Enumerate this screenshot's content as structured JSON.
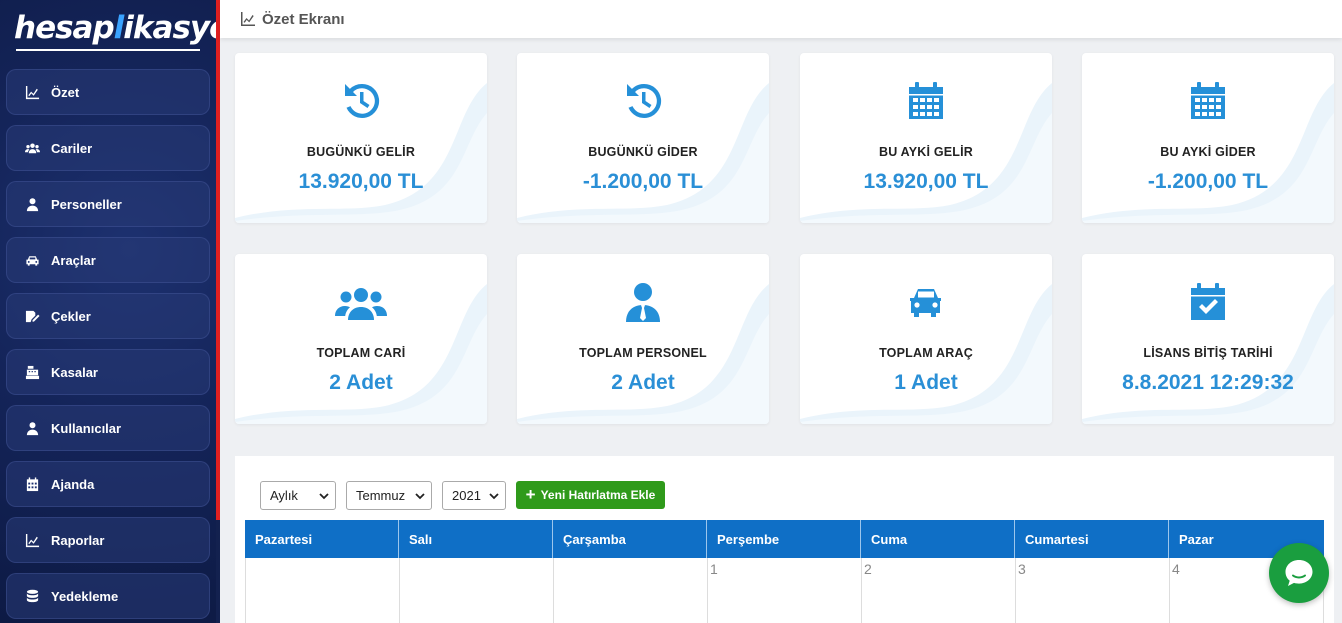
{
  "app": {
    "logo_left": "hesap",
    "logo_accent": "l",
    "logo_right": "ikasyon"
  },
  "sidebar": {
    "items": [
      {
        "label": "Özet",
        "icon": "chart-line-icon"
      },
      {
        "label": "Cariler",
        "icon": "users-icon"
      },
      {
        "label": "Personeller",
        "icon": "user-icon"
      },
      {
        "label": "Araçlar",
        "icon": "car-icon"
      },
      {
        "label": "Çekler",
        "icon": "check-edit-icon"
      },
      {
        "label": "Kasalar",
        "icon": "cash-register-icon"
      },
      {
        "label": "Kullanıcılar",
        "icon": "user-icon"
      },
      {
        "label": "Ajanda",
        "icon": "calendar-icon"
      },
      {
        "label": "Raporlar",
        "icon": "chart-line-icon"
      },
      {
        "label": "Yedekleme",
        "icon": "database-icon"
      }
    ]
  },
  "header": {
    "title": "Özet Ekranı"
  },
  "cards": [
    {
      "label": "BUGÜNKÜ GELİR",
      "value": "13.920,00 TL",
      "icon": "history-icon"
    },
    {
      "label": "BUGÜNKÜ GİDER",
      "value": "-1.200,00 TL",
      "icon": "history-icon"
    },
    {
      "label": "BU AYKİ GELİR",
      "value": "13.920,00 TL",
      "icon": "calendar-icon"
    },
    {
      "label": "BU AYKİ GİDER",
      "value": "-1.200,00 TL",
      "icon": "calendar-icon"
    },
    {
      "label": "TOPLAM CARİ",
      "value": "2 Adet",
      "icon": "users-icon"
    },
    {
      "label": "TOPLAM PERSONEL",
      "value": "2 Adet",
      "icon": "user-tie-icon"
    },
    {
      "label": "TOPLAM ARAÇ",
      "value": "1 Adet",
      "icon": "car-icon"
    },
    {
      "label": "LİSANS BİTİŞ TARİHİ",
      "value": "8.8.2021 12:29:32",
      "icon": "calendar-check-icon"
    }
  ],
  "calendar": {
    "view_select": "Aylık",
    "month_select": "Temmuz",
    "year_select": "2021",
    "add_button": "Yeni Hatırlatma Ekle",
    "days": [
      "Pazartesi",
      "Salı",
      "Çarşamba",
      "Perşembe",
      "Cuma",
      "Cumartesi",
      "Pazar"
    ],
    "first_row": [
      "",
      "",
      "",
      "1",
      "2",
      "3",
      "4"
    ]
  },
  "colors": {
    "sidebar_bg": "#142459",
    "accent_red": "#e02020",
    "card_value": "#2a8fd6",
    "calendar_header": "#0f6fc6",
    "add_button": "#2f9a1b",
    "chat": "#1a9e3f"
  }
}
